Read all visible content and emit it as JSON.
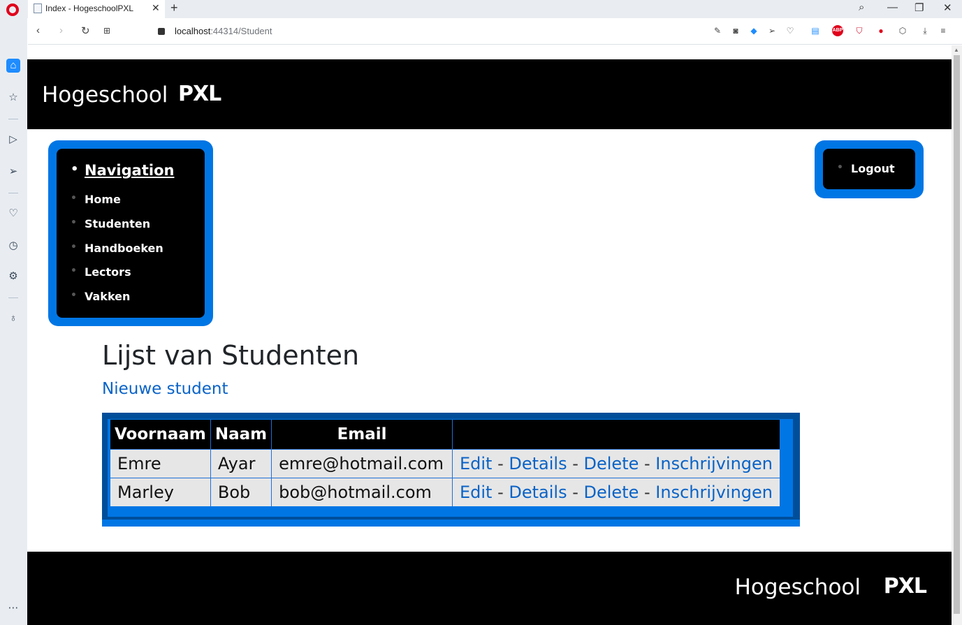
{
  "browser": {
    "tab_title": "Index - HogeschoolPXL",
    "url_host": "localhost",
    "url_rest": ":44314/Student"
  },
  "site": {
    "brand": "Hogeschool",
    "logo": "PXL",
    "footer_brand": "Hogeschool",
    "footer_logo": "PXL"
  },
  "nav": {
    "heading": "Navigation",
    "items": [
      "Home",
      "Studenten",
      "Handboeken",
      "Lectors",
      "Vakken"
    ],
    "logout": "Logout"
  },
  "main": {
    "title": "Lijst van Studenten",
    "new_link": "Nieuwe student"
  },
  "table": {
    "headers": [
      "Voornaam",
      "Naam",
      "Email",
      ""
    ],
    "rows": [
      {
        "voornaam": "Emre",
        "naam": "Ayar",
        "email": "emre@hotmail.com"
      },
      {
        "voornaam": "Marley",
        "naam": "Bob",
        "email": "bob@hotmail.com"
      }
    ],
    "actions": {
      "edit": "Edit",
      "details": "Details",
      "delete": "Delete",
      "inschrijvingen": "Inschrijvingen",
      "separator": " - "
    }
  },
  "colors": {
    "accent": "#0076e5",
    "header_bg": "#000000",
    "link": "#0a63c7"
  }
}
